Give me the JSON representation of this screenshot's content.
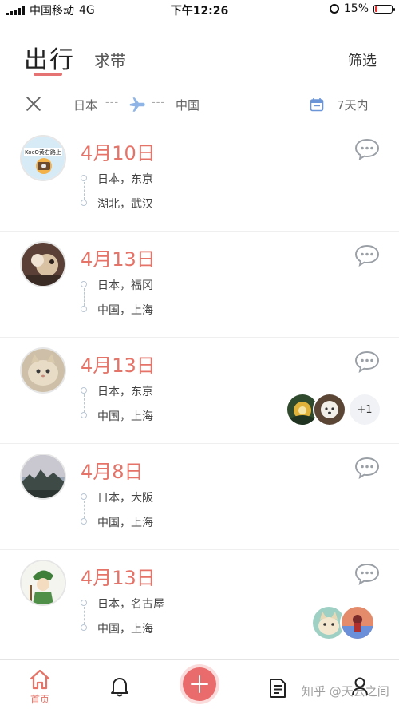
{
  "status_bar": {
    "carrier": "中国移动",
    "network": "4G",
    "time": "下午12:26",
    "battery_percent": "15%",
    "battery_level": 0.15
  },
  "header": {
    "active_tab": "出行",
    "other_tab": "求带",
    "filter_label": "筛选"
  },
  "route_filter": {
    "from": "日本",
    "dashes": "---",
    "to": "中国",
    "date_range": "7天内",
    "icons": [
      "close-icon",
      "airplane-icon",
      "calendar-icon"
    ]
  },
  "trips": [
    {
      "date": "4月10日",
      "from": "日本，东京",
      "to": "湖北，武汉",
      "avatar_text": "KocO黄右路上"
    },
    {
      "date": "4月13日",
      "from": "日本，福冈",
      "to": "中国，上海"
    },
    {
      "date": "4月13日",
      "from": "日本，东京",
      "to": "中国，上海",
      "extra_companions": "+1"
    },
    {
      "date": "4月8日",
      "from": "日本，大阪",
      "to": "中国，上海"
    },
    {
      "date": "4月13日",
      "from": "日本，名古屋",
      "to": "中国，上海"
    }
  ],
  "bottom_nav": {
    "home_label": "首页",
    "icons": [
      "home-icon",
      "bell-icon",
      "plus-icon",
      "document-icon",
      "user-icon"
    ],
    "watermark": "知乎 @天云之间"
  },
  "colors": {
    "accent": "#e57368",
    "plus_button": "#ea6b6b",
    "plane": "#8fb4e6",
    "calendar": "#6b95d6"
  }
}
